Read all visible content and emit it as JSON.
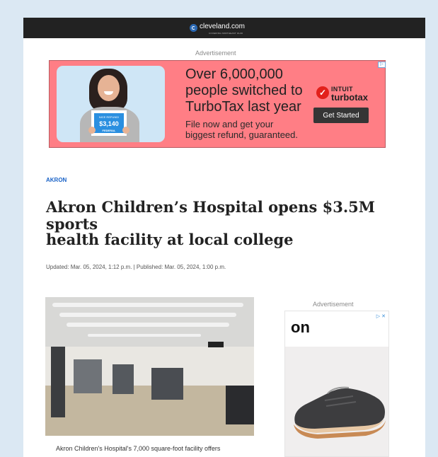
{
  "site": {
    "logo_text": "cleveland.com",
    "logo_subtext": "COVERING NORTHEAST OHIO"
  },
  "top_ad": {
    "label": "Advertisement",
    "headline_lines": [
      "Over 6,000,000",
      "people switched to",
      "TurboTax last year"
    ],
    "subtext_lines": [
      "File now and get your",
      "biggest refund, guaranteed."
    ],
    "sign_line1": "NICE REFUND!",
    "sign_amount": "$3,140",
    "sign_line3": "FEDERAL",
    "brand_top": "INTUIT",
    "brand_name": "turbotax",
    "cta": "Get Started",
    "adchoices": "▷"
  },
  "article": {
    "section": "AKRON",
    "headline_line1": "Akron Children’s Hospital opens $3.5M sports",
    "headline_line2": "health facility at local college",
    "dates": "Updated: Mar. 05, 2024, 1:12 p.m. | Published: Mar. 05, 2024, 1:00 p.m.",
    "caption": "Akron Children's Hospital's 7,000 square-foot facility offers"
  },
  "side_ad": {
    "label": "Advertisement",
    "brand_logo": "on",
    "icons": "▷ ✕"
  },
  "colors": {
    "page_bg": "#dbe8f3",
    "topbar": "#222222",
    "banner": "#ff7e85",
    "section_link": "#1a63c7"
  }
}
